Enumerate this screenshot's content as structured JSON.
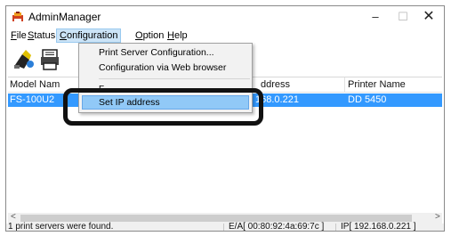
{
  "window": {
    "title": "AdminManager",
    "controls": {
      "minimize": "–",
      "maximize": "☐",
      "close": "✕"
    }
  },
  "menu": {
    "file": {
      "mnemonic": "F",
      "rest": "ile"
    },
    "status": {
      "mnemonic": "S",
      "rest": "tatus"
    },
    "configuration": {
      "mnemonic": "C",
      "rest": "onfiguration"
    },
    "option": {
      "mnemonic": "O",
      "rest": "ption"
    },
    "help": {
      "mnemonic": "H",
      "rest": "elp"
    }
  },
  "toolbar": {
    "icons": [
      "search-printer-icon",
      "printer-settings-icon"
    ]
  },
  "dropdown": {
    "items": [
      "Print Server Configuration...",
      "Configuration via Web browser",
      "Set IP address"
    ],
    "partial_item": "F"
  },
  "list": {
    "columns": {
      "model": "Model Nam",
      "address": "ddress",
      "printer": "Printer Name"
    },
    "rows": [
      {
        "model": "FS-100U2",
        "address": "168.0.221",
        "printer": "DD 5450"
      }
    ]
  },
  "scrollbar": {
    "left_arrow": "<",
    "right_arrow": ">"
  },
  "status": {
    "message": "1 print servers were found.",
    "mac": "E/A[ 00:80:92:4a:69:7c ]",
    "ip": "IP[ 192.168.0.221 ]"
  },
  "colors": {
    "selection": "#3399ff",
    "menu_highlight": "#91c9f7",
    "callout": "#111111"
  }
}
